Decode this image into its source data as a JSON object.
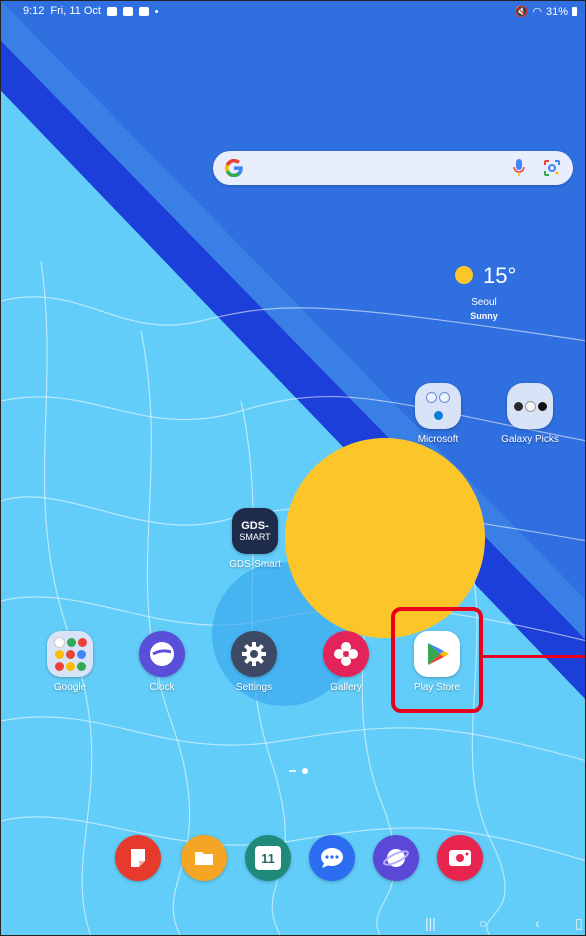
{
  "status_bar": {
    "time": "9:12",
    "date": "Fri, 11 Oct",
    "battery": "31%"
  },
  "search": {
    "provider": "Google"
  },
  "weather": {
    "temperature": "15°",
    "city": "Seoul",
    "condition": "Sunny"
  },
  "folders": [
    {
      "label": "Microsoft"
    },
    {
      "label": "Galaxy Picks"
    }
  ],
  "widget_app": {
    "label": "GDS-Smart",
    "logo_text_1": "GDS-",
    "logo_text_2": "SMART"
  },
  "apps": [
    {
      "label": "Google"
    },
    {
      "label": "Clock"
    },
    {
      "label": "Settings"
    },
    {
      "label": "Gallery"
    },
    {
      "label": "Play Store"
    }
  ],
  "dock": [
    {
      "icon": "notes-icon"
    },
    {
      "icon": "my-files-icon"
    },
    {
      "icon": "calendar-icon",
      "text": "11"
    },
    {
      "icon": "messages-icon"
    },
    {
      "icon": "internet-icon"
    },
    {
      "icon": "screen-recorder-icon"
    }
  ],
  "colors": {
    "highlight": "#e8001c",
    "sun_circle": "#fcc62a",
    "wallpaper_dark": "#2f6fe0",
    "wallpaper_light": "#5cc8f7"
  },
  "page_indicator": {
    "current": 2,
    "count": 2
  }
}
